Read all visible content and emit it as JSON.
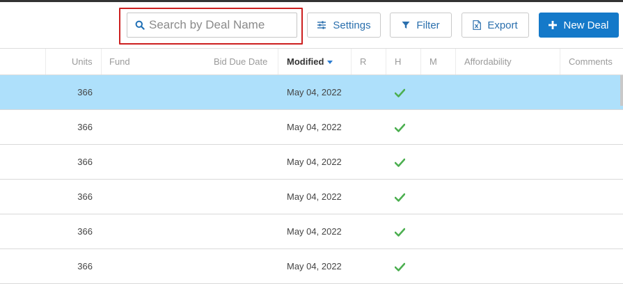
{
  "toolbar": {
    "search_placeholder": "Search by Deal Name",
    "settings_label": "Settings",
    "filter_label": "Filter",
    "export_label": "Export",
    "new_deal_label": "New Deal"
  },
  "columns": {
    "units": "Units",
    "fund": "Fund",
    "bid_due_date": "Bid Due Date",
    "modified": "Modified",
    "r": "R",
    "h": "H",
    "m": "M",
    "affordability": "Affordability",
    "comments": "Comments"
  },
  "rows": [
    {
      "units": "366",
      "modified": "May 04, 2022",
      "h_checked": true,
      "selected": true
    },
    {
      "units": "366",
      "modified": "May 04, 2022",
      "h_checked": true,
      "selected": false
    },
    {
      "units": "366",
      "modified": "May 04, 2022",
      "h_checked": true,
      "selected": false
    },
    {
      "units": "366",
      "modified": "May 04, 2022",
      "h_checked": true,
      "selected": false
    },
    {
      "units": "366",
      "modified": "May 04, 2022",
      "h_checked": true,
      "selected": false
    },
    {
      "units": "366",
      "modified": "May 04, 2022",
      "h_checked": true,
      "selected": false
    }
  ],
  "colors": {
    "accent": "#1479c9",
    "selected_row": "#aee0fb",
    "highlight_border": "#cc1f1f",
    "check_green": "#4caf50"
  },
  "sort": {
    "column": "modified",
    "direction": "desc"
  }
}
